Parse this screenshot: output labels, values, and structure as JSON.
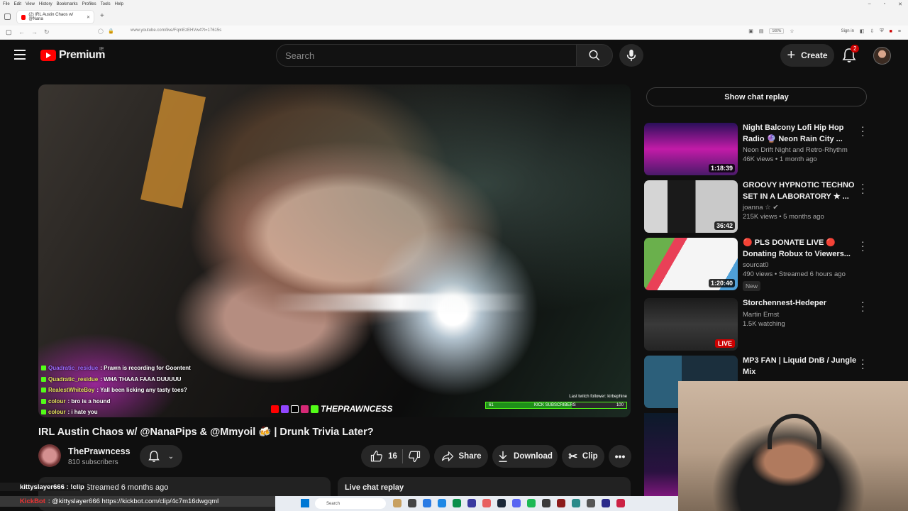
{
  "browser": {
    "menu": [
      "File",
      "Edit",
      "View",
      "History",
      "Bookmarks",
      "Profiles",
      "Tools",
      "Help"
    ],
    "tab_title": "(2) IRL Austin Chaos w/ @Nana",
    "url": "www.youtube.com/live/FqmEzEHVw4?t=17615s",
    "zoom": "160%",
    "sign_in": "Sign in"
  },
  "header": {
    "logo_text": "Premium",
    "country": "IE",
    "search_placeholder": "Search",
    "create_label": "Create",
    "notif_count": "2"
  },
  "player": {
    "chat": [
      {
        "user": "Quadratic_residue",
        "msg": ": Prawn is recording for Goontent"
      },
      {
        "user": "Quadratic_residue",
        "msg": ": WHA THAAA FAAA DUUUUU"
      },
      {
        "user": "RealestWhiteBoy",
        "msg": ": Yall been licking any tasty toes?"
      },
      {
        "user": "colour",
        "msg": ": bro is a hound"
      },
      {
        "user": "colour",
        "msg": ": i hate you"
      }
    ],
    "brand": "THEPRAWNCESS",
    "last_follower": "Last twitch follower: kirbephine",
    "kick_label": "KICK SUBSCRIBERS",
    "kick_current": "61",
    "kick_goal": "100",
    "kick_progress": 0.61
  },
  "video": {
    "title": "IRL Austin Chaos w/ @NanaPips & @Mmyoil 🍻 | Drunk Trivia Later?",
    "channel": "ThePrawncess",
    "subscribers": "810 subscribers",
    "likes": "16",
    "share": "Share",
    "download": "Download",
    "clip": "Clip",
    "streamed": "Streamed 6 months ago",
    "live_chat_replay": "Live chat replay"
  },
  "sidebar": {
    "show_chat": "Show chat replay",
    "recs": [
      {
        "title": "Night Balcony Lofi Hip Hop Radio 🔮 Neon Rain City ...",
        "channel": "Neon Drift Night and Retro-Rhythm",
        "meta": "46K views • 1 month ago",
        "duration": "1:18:39"
      },
      {
        "title": "GROOVY HYPNOTIC TECHNO SET IN A LABORATORY ★ ...",
        "channel": "joanna ☆ ✔",
        "meta": "215K views • 5 months ago",
        "duration": "36:42"
      },
      {
        "title": "🔴 PLS DONATE LIVE 🔴 Donating Robux to Viewers...",
        "channel": "sourcat0",
        "meta": "490 views • Streamed 6 hours ago",
        "duration": "1:20:40",
        "badge": "New"
      },
      {
        "title": "Storchennest-Hedeper",
        "channel": "Martin Ernst",
        "meta": "1.5K watching",
        "live": "LIVE"
      },
      {
        "title": "MP3 FAN | Liquid DnB / Jungle Mix"
      }
    ]
  },
  "overlays": {
    "kitty": "kittyslayer666 : !clip",
    "kickbot_name": "KickBot",
    "kickbot_msg": ": @kittyslayer666 https://kickbot.com/clip/4c7m16dwgqml"
  },
  "taskbar": {
    "search": "Search"
  }
}
